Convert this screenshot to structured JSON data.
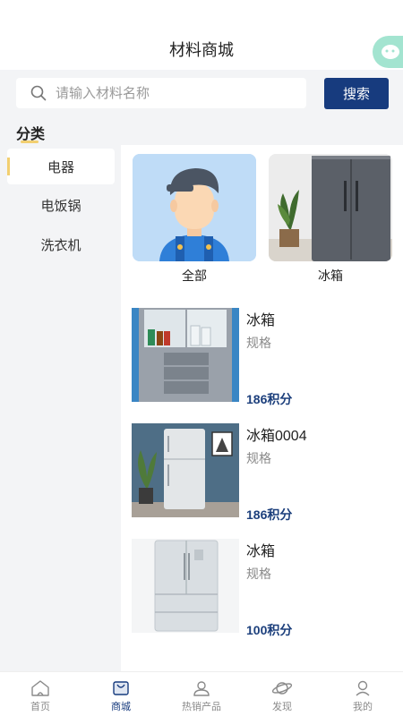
{
  "header": {
    "title": "材料商城"
  },
  "search": {
    "placeholder": "请输入材料名称",
    "button_label": "搜索"
  },
  "category_heading": "分类",
  "sidebar": {
    "items": [
      {
        "label": "电器",
        "active": true
      },
      {
        "label": "电饭锅",
        "active": false
      },
      {
        "label": "洗衣机",
        "active": false
      }
    ]
  },
  "categories": [
    {
      "label": "全部",
      "icon": "worker-avatar"
    },
    {
      "label": "冰箱",
      "icon": "fridge-photo"
    }
  ],
  "products": [
    {
      "name": "冰箱",
      "spec": "规格",
      "price": "186积分"
    },
    {
      "name": "冰箱0004",
      "spec": "规格",
      "price": "186积分"
    },
    {
      "name": "冰箱",
      "spec": "规格",
      "price": "100积分"
    }
  ],
  "tabs": [
    {
      "label": "首页",
      "icon": "home-icon",
      "active": false
    },
    {
      "label": "商城",
      "icon": "shop-icon",
      "active": true
    },
    {
      "label": "热销产品",
      "icon": "user-icon",
      "active": false
    },
    {
      "label": "发现",
      "icon": "planet-icon",
      "active": false
    },
    {
      "label": "我的",
      "icon": "profile-icon",
      "active": false
    }
  ],
  "colors": {
    "accent": "#173b7e",
    "highlight": "#f2cf70",
    "price": "#1c3f7c"
  }
}
